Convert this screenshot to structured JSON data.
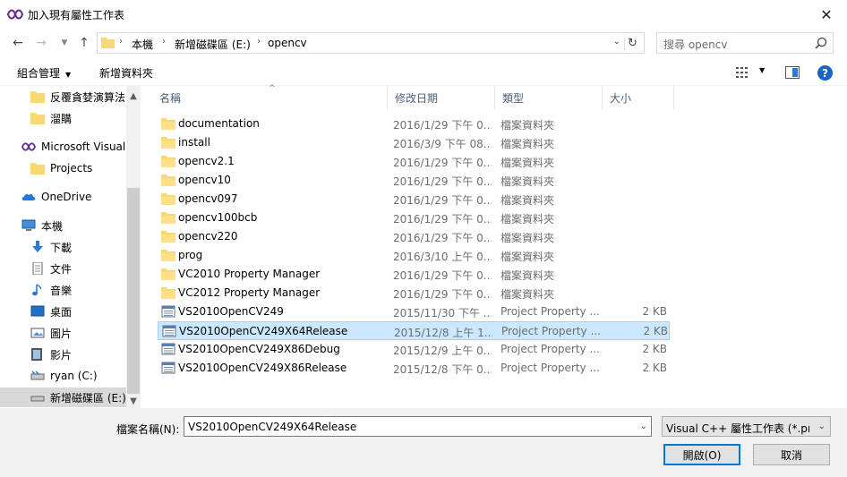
{
  "window": {
    "title": "加入現有屬性工作表"
  },
  "address": {
    "crumbs": [
      "本機",
      "新增磁碟區 (E:)",
      "opencv"
    ]
  },
  "search": {
    "placeholder": "搜尋 opencv"
  },
  "toolbar": {
    "organize": "組合管理",
    "new_folder": "新增資料夾"
  },
  "nav": {
    "items": [
      {
        "label": "反覆貪婪演算法",
        "icon": "folder-icon"
      },
      {
        "label": "溜購",
        "icon": "folder-icon"
      },
      {
        "label": "Microsoft Visual",
        "icon": "visual-studio-icon"
      },
      {
        "label": "Projects",
        "icon": "folder-icon"
      },
      {
        "label": "OneDrive",
        "icon": "onedrive-icon"
      },
      {
        "label": "本機",
        "icon": "computer-icon"
      },
      {
        "label": "下載",
        "icon": "download-icon"
      },
      {
        "label": "文件",
        "icon": "document-icon"
      },
      {
        "label": "音樂",
        "icon": "music-icon"
      },
      {
        "label": "桌面",
        "icon": "desktop-icon"
      },
      {
        "label": "圖片",
        "icon": "picture-icon"
      },
      {
        "label": "影片",
        "icon": "video-icon"
      },
      {
        "label": "ryan (C:)",
        "icon": "drive-icon"
      },
      {
        "label": "新增磁碟區 (E:)",
        "icon": "drive-icon"
      }
    ]
  },
  "columns": {
    "name": "名稱",
    "date": "修改日期",
    "type": "類型",
    "size": "大小"
  },
  "files": [
    {
      "name": "documentation",
      "date": "2016/1/29 下午 0...",
      "type": "檔案資料夾",
      "size": "",
      "kind": "folder"
    },
    {
      "name": "install",
      "date": "2016/3/9 下午 08...",
      "type": "檔案資料夾",
      "size": "",
      "kind": "folder"
    },
    {
      "name": "opencv2.1",
      "date": "2016/1/29 下午 0...",
      "type": "檔案資料夾",
      "size": "",
      "kind": "folder"
    },
    {
      "name": "opencv10",
      "date": "2016/1/29 下午 0...",
      "type": "檔案資料夾",
      "size": "",
      "kind": "folder"
    },
    {
      "name": "opencv097",
      "date": "2016/1/29 下午 0...",
      "type": "檔案資料夾",
      "size": "",
      "kind": "folder"
    },
    {
      "name": "opencv100bcb",
      "date": "2016/1/29 下午 0...",
      "type": "檔案資料夾",
      "size": "",
      "kind": "folder"
    },
    {
      "name": "opencv220",
      "date": "2016/1/29 下午 0...",
      "type": "檔案資料夾",
      "size": "",
      "kind": "folder"
    },
    {
      "name": "prog",
      "date": "2016/3/10 上午 0...",
      "type": "檔案資料夾",
      "size": "",
      "kind": "folder"
    },
    {
      "name": "VC2010 Property Manager",
      "date": "2016/1/29 下午 0...",
      "type": "檔案資料夾",
      "size": "",
      "kind": "folder"
    },
    {
      "name": "VC2012 Property Manager",
      "date": "2016/1/29 下午 0...",
      "type": "檔案資料夾",
      "size": "",
      "kind": "folder"
    },
    {
      "name": "VS2010OpenCV249",
      "date": "2015/11/30 下午 ...",
      "type": "Project Property ...",
      "size": "2 KB",
      "kind": "file"
    },
    {
      "name": "VS2010OpenCV249X64Release",
      "date": "2015/12/8 上午 1...",
      "type": "Project Property ...",
      "size": "2 KB",
      "kind": "file"
    },
    {
      "name": "VS2010OpenCV249X86Debug",
      "date": "2015/12/9 上午 0...",
      "type": "Project Property ...",
      "size": "2 KB",
      "kind": "file"
    },
    {
      "name": "VS2010OpenCV249X86Release",
      "date": "2015/12/8 下午 0...",
      "type": "Project Property ...",
      "size": "2 KB",
      "kind": "file"
    }
  ],
  "selected_index": 11,
  "bottom": {
    "filename_label": "檔案名稱(N):",
    "filename_value": "VS2010OpenCV249X64Release",
    "filetype_value": "Visual C++ 屬性工作表 (*.props)",
    "open_label": "開啟(O)",
    "cancel_label": "取消"
  },
  "colors": {
    "selection_bg": "#cce8ff",
    "selection_border": "#99d1ff",
    "folder": "#f8d775",
    "accent": "#0078d7"
  }
}
